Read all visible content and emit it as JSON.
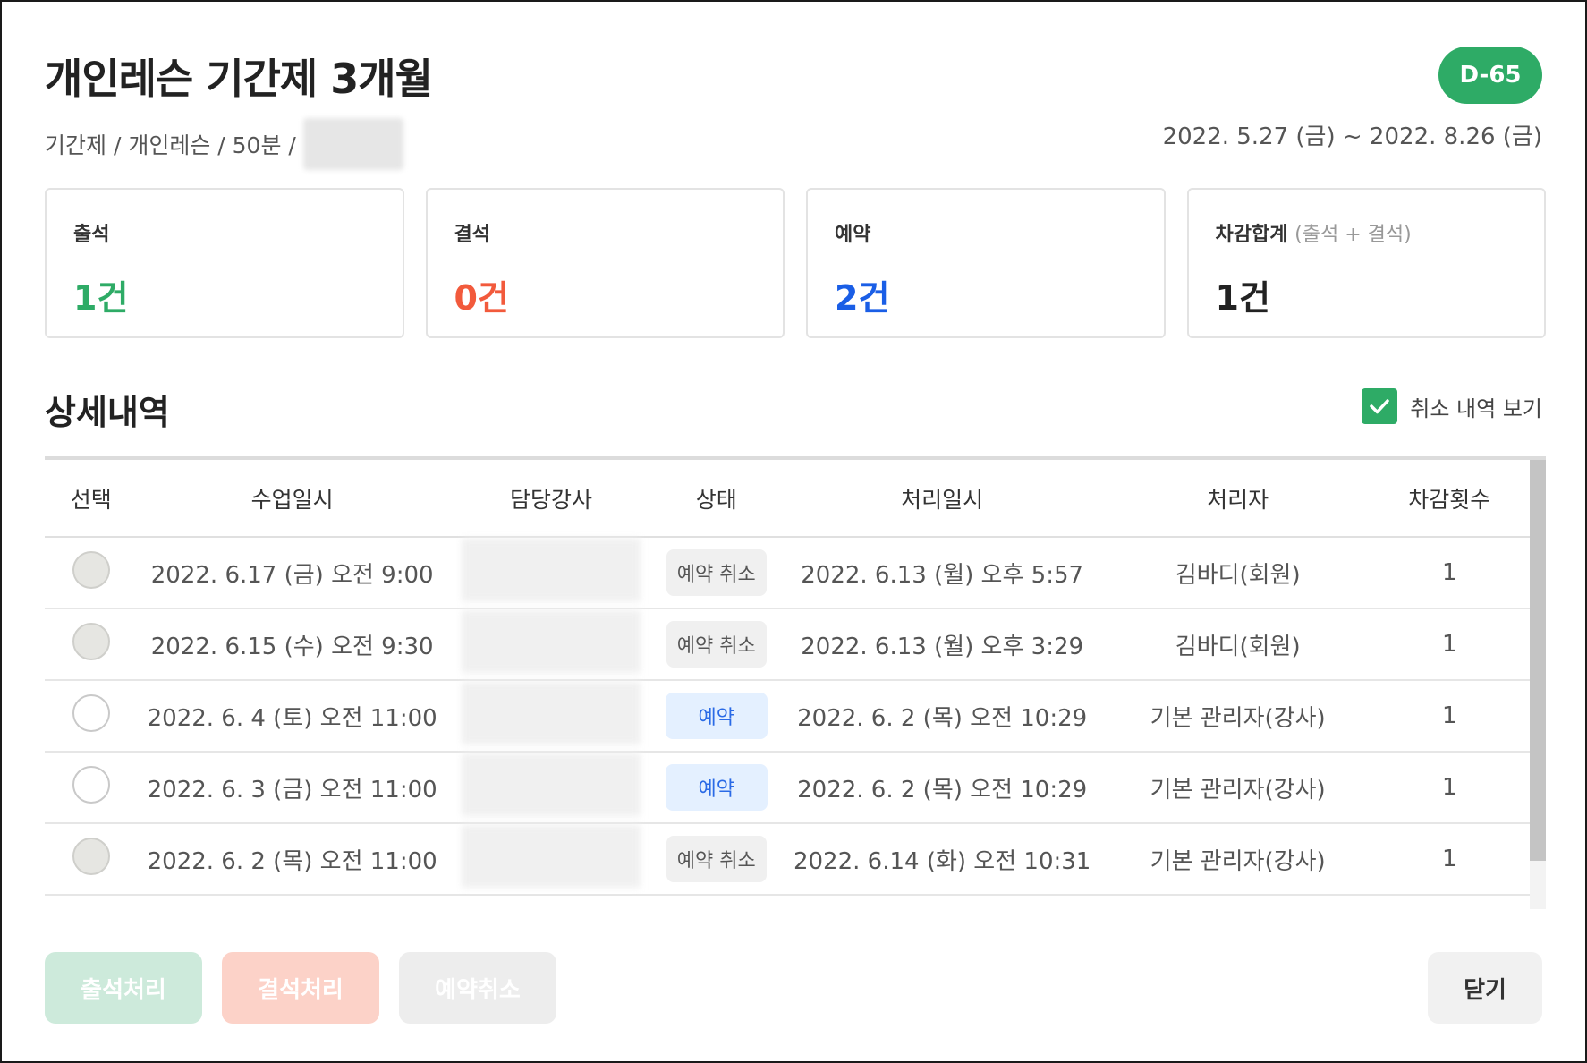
{
  "header": {
    "title": "개인레슨 기간제 3개월",
    "d_badge": "D-65",
    "subtitle": "기간제 / 개인레슨 / 50분 /",
    "period": "2022. 5.27 (금) ~ 2022. 8.26 (금)"
  },
  "cards": [
    {
      "label": "출석",
      "sublabel": "",
      "value": "1건",
      "color": "#2eab66"
    },
    {
      "label": "결석",
      "sublabel": "",
      "value": "0건",
      "color": "#f25a3c"
    },
    {
      "label": "예약",
      "sublabel": "",
      "value": "2건",
      "color": "#1a5ee6"
    },
    {
      "label": "차감합계",
      "sublabel": "(출석 + 결석)",
      "value": "1건",
      "color": "#222222"
    }
  ],
  "details": {
    "title": "상세내역",
    "show_cancel_label": "취소 내역 보기",
    "show_cancel_checked": true
  },
  "table": {
    "headers": [
      "선택",
      "수업일시",
      "담당강사",
      "상태",
      "처리일시",
      "처리자",
      "차감횟수"
    ],
    "rows": [
      {
        "class_time": "2022. 6.17 (금) 오전 9:00",
        "status": "예약 취소",
        "processed_at": "2022. 6.13 (월) 오후 5:57",
        "processor": "김바디(회원)",
        "deduct": "1"
      },
      {
        "class_time": "2022. 6.15 (수) 오전 9:30",
        "status": "예약 취소",
        "processed_at": "2022. 6.13 (월) 오후 3:29",
        "processor": "김바디(회원)",
        "deduct": "1"
      },
      {
        "class_time": "2022. 6. 4 (토) 오전 11:00",
        "status": "예약",
        "processed_at": "2022. 6. 2 (목) 오전 10:29",
        "processor": "기본 관리자(강사)",
        "deduct": "1"
      },
      {
        "class_time": "2022. 6. 3 (금) 오전 11:00",
        "status": "예약",
        "processed_at": "2022. 6. 2 (목) 오전 10:29",
        "processor": "기본 관리자(강사)",
        "deduct": "1"
      },
      {
        "class_time": "2022. 6. 2 (목) 오전 11:00",
        "status": "예약 취소",
        "processed_at": "2022. 6.14 (화) 오전 10:31",
        "processor": "기본 관리자(강사)",
        "deduct": "1"
      }
    ]
  },
  "buttons": {
    "attend": "출석처리",
    "absent": "결석처리",
    "cancel_reservation": "예약취소",
    "close": "닫기"
  }
}
